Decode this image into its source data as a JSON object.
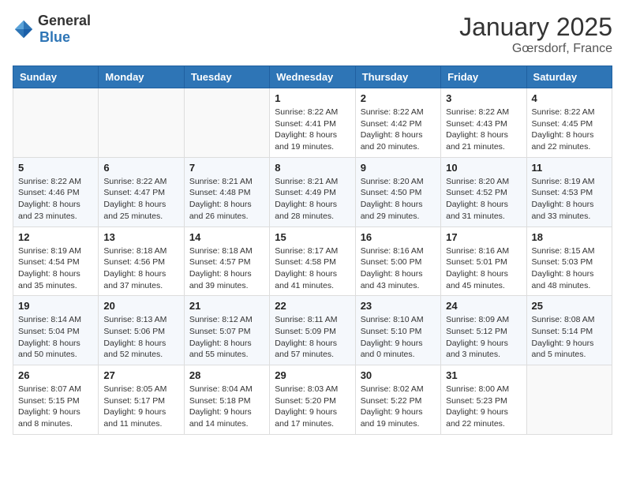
{
  "logo": {
    "text_general": "General",
    "text_blue": "Blue"
  },
  "header": {
    "month": "January 2025",
    "location": "Gœrsdorf, France"
  },
  "days_of_week": [
    "Sunday",
    "Monday",
    "Tuesday",
    "Wednesday",
    "Thursday",
    "Friday",
    "Saturday"
  ],
  "weeks": [
    [
      {
        "day": "",
        "info": ""
      },
      {
        "day": "",
        "info": ""
      },
      {
        "day": "",
        "info": ""
      },
      {
        "day": "1",
        "info": "Sunrise: 8:22 AM\nSunset: 4:41 PM\nDaylight: 8 hours\nand 19 minutes."
      },
      {
        "day": "2",
        "info": "Sunrise: 8:22 AM\nSunset: 4:42 PM\nDaylight: 8 hours\nand 20 minutes."
      },
      {
        "day": "3",
        "info": "Sunrise: 8:22 AM\nSunset: 4:43 PM\nDaylight: 8 hours\nand 21 minutes."
      },
      {
        "day": "4",
        "info": "Sunrise: 8:22 AM\nSunset: 4:45 PM\nDaylight: 8 hours\nand 22 minutes."
      }
    ],
    [
      {
        "day": "5",
        "info": "Sunrise: 8:22 AM\nSunset: 4:46 PM\nDaylight: 8 hours\nand 23 minutes."
      },
      {
        "day": "6",
        "info": "Sunrise: 8:22 AM\nSunset: 4:47 PM\nDaylight: 8 hours\nand 25 minutes."
      },
      {
        "day": "7",
        "info": "Sunrise: 8:21 AM\nSunset: 4:48 PM\nDaylight: 8 hours\nand 26 minutes."
      },
      {
        "day": "8",
        "info": "Sunrise: 8:21 AM\nSunset: 4:49 PM\nDaylight: 8 hours\nand 28 minutes."
      },
      {
        "day": "9",
        "info": "Sunrise: 8:20 AM\nSunset: 4:50 PM\nDaylight: 8 hours\nand 29 minutes."
      },
      {
        "day": "10",
        "info": "Sunrise: 8:20 AM\nSunset: 4:52 PM\nDaylight: 8 hours\nand 31 minutes."
      },
      {
        "day": "11",
        "info": "Sunrise: 8:19 AM\nSunset: 4:53 PM\nDaylight: 8 hours\nand 33 minutes."
      }
    ],
    [
      {
        "day": "12",
        "info": "Sunrise: 8:19 AM\nSunset: 4:54 PM\nDaylight: 8 hours\nand 35 minutes."
      },
      {
        "day": "13",
        "info": "Sunrise: 8:18 AM\nSunset: 4:56 PM\nDaylight: 8 hours\nand 37 minutes."
      },
      {
        "day": "14",
        "info": "Sunrise: 8:18 AM\nSunset: 4:57 PM\nDaylight: 8 hours\nand 39 minutes."
      },
      {
        "day": "15",
        "info": "Sunrise: 8:17 AM\nSunset: 4:58 PM\nDaylight: 8 hours\nand 41 minutes."
      },
      {
        "day": "16",
        "info": "Sunrise: 8:16 AM\nSunset: 5:00 PM\nDaylight: 8 hours\nand 43 minutes."
      },
      {
        "day": "17",
        "info": "Sunrise: 8:16 AM\nSunset: 5:01 PM\nDaylight: 8 hours\nand 45 minutes."
      },
      {
        "day": "18",
        "info": "Sunrise: 8:15 AM\nSunset: 5:03 PM\nDaylight: 8 hours\nand 48 minutes."
      }
    ],
    [
      {
        "day": "19",
        "info": "Sunrise: 8:14 AM\nSunset: 5:04 PM\nDaylight: 8 hours\nand 50 minutes."
      },
      {
        "day": "20",
        "info": "Sunrise: 8:13 AM\nSunset: 5:06 PM\nDaylight: 8 hours\nand 52 minutes."
      },
      {
        "day": "21",
        "info": "Sunrise: 8:12 AM\nSunset: 5:07 PM\nDaylight: 8 hours\nand 55 minutes."
      },
      {
        "day": "22",
        "info": "Sunrise: 8:11 AM\nSunset: 5:09 PM\nDaylight: 8 hours\nand 57 minutes."
      },
      {
        "day": "23",
        "info": "Sunrise: 8:10 AM\nSunset: 5:10 PM\nDaylight: 9 hours\nand 0 minutes."
      },
      {
        "day": "24",
        "info": "Sunrise: 8:09 AM\nSunset: 5:12 PM\nDaylight: 9 hours\nand 3 minutes."
      },
      {
        "day": "25",
        "info": "Sunrise: 8:08 AM\nSunset: 5:14 PM\nDaylight: 9 hours\nand 5 minutes."
      }
    ],
    [
      {
        "day": "26",
        "info": "Sunrise: 8:07 AM\nSunset: 5:15 PM\nDaylight: 9 hours\nand 8 minutes."
      },
      {
        "day": "27",
        "info": "Sunrise: 8:05 AM\nSunset: 5:17 PM\nDaylight: 9 hours\nand 11 minutes."
      },
      {
        "day": "28",
        "info": "Sunrise: 8:04 AM\nSunset: 5:18 PM\nDaylight: 9 hours\nand 14 minutes."
      },
      {
        "day": "29",
        "info": "Sunrise: 8:03 AM\nSunset: 5:20 PM\nDaylight: 9 hours\nand 17 minutes."
      },
      {
        "day": "30",
        "info": "Sunrise: 8:02 AM\nSunset: 5:22 PM\nDaylight: 9 hours\nand 19 minutes."
      },
      {
        "day": "31",
        "info": "Sunrise: 8:00 AM\nSunset: 5:23 PM\nDaylight: 9 hours\nand 22 minutes."
      },
      {
        "day": "",
        "info": ""
      }
    ]
  ]
}
